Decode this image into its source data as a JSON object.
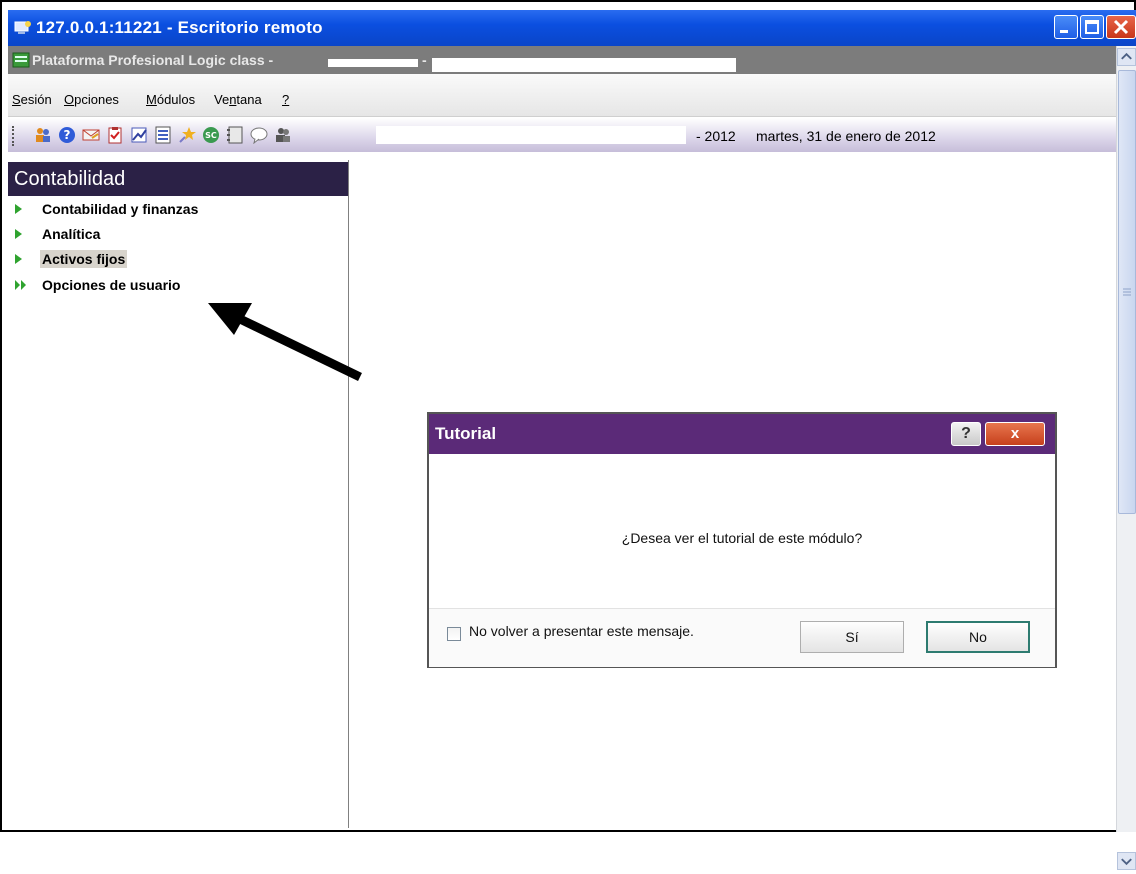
{
  "window": {
    "rdp_title": "127.0.0.1:11221 - Escritorio remoto",
    "app_title": "Plataforma Profesional Logic class -",
    "app_title_separator": "-"
  },
  "menubar": {
    "items": [
      "Sesión",
      "Opciones",
      "Módulos",
      "Ventana",
      "?"
    ]
  },
  "toolbar": {
    "icons": [
      "people-icon",
      "help-icon",
      "mail-icon",
      "clipboard-icon",
      "chart-icon",
      "list-icon",
      "star-icon",
      "sc-icon",
      "notebook-icon",
      "chat-icon",
      "users-icon"
    ],
    "year_text": "- 2012",
    "date_text": "martes, 31 de enero de 2012"
  },
  "sidebar": {
    "title": "Contabilidad",
    "items": [
      {
        "label": "Contabilidad y finanzas"
      },
      {
        "label": "Analítica"
      },
      {
        "label": "Activos fijos"
      },
      {
        "label": "Opciones de usuario"
      }
    ],
    "selected": "Activos fijos"
  },
  "dialog": {
    "title": "Tutorial",
    "help_label": "?",
    "close_label": "x",
    "message": "¿Desea ver el tutorial de este módulo?",
    "checkbox_label": "No volver a presentar este mensaje.",
    "checkbox_checked": false,
    "yes_label": "Sí",
    "no_label": "No"
  },
  "colors": {
    "rdp_titlebar": "#0b4fe0",
    "dialog_titlebar": "#5b2a78",
    "sidebar_header": "#2b2146",
    "nav_arrow": "#2fa32f"
  }
}
